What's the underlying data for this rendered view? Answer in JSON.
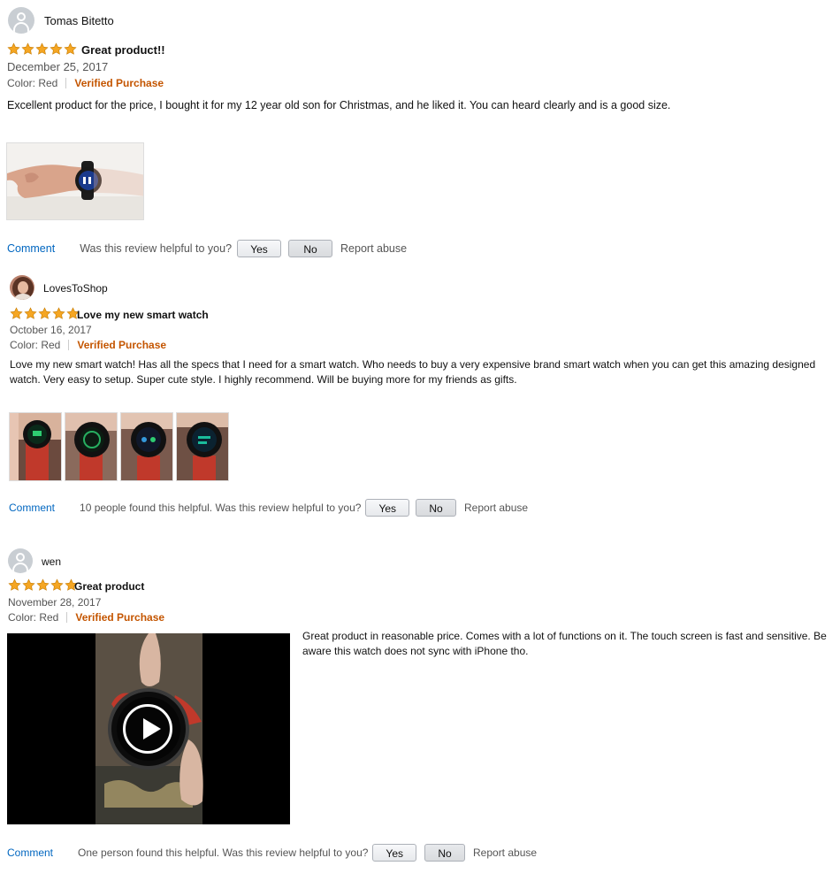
{
  "colors": {
    "link": "#0066c0",
    "verified": "#c45500",
    "star": "#f5a623"
  },
  "reviews": [
    {
      "author": "Tomas Bitetto",
      "rating": 5,
      "title": "Great product!!",
      "date": "December 25, 2017",
      "color": "Color: Red",
      "verified": "Verified Purchase",
      "text": "Excellent product for the price, I bought it for my 12 year old son for Christmas, and he liked it. You can heard clearly and is a good size.",
      "helpful": "Was this review helpful to you?",
      "comment": "Comment",
      "yes": "Yes",
      "no": "No",
      "report": "Report abuse"
    },
    {
      "author": "LovesToShop",
      "rating": 5,
      "title": "Love my new smart watch",
      "date": "October 16, 2017",
      "color": "Color: Red",
      "verified": "Verified Purchase",
      "text": "Love my new smart watch! Has all the specs that I need for a smart watch. Who needs to buy a very expensive brand smart watch when you can get this amazing designed watch. Very easy to setup. Super cute style. I highly recommend. Will be buying more for my friends as gifts.",
      "helpful": "10 people found this helpful. Was this review helpful to you?",
      "comment": "Comment",
      "yes": "Yes",
      "no": "No",
      "report": "Report abuse"
    },
    {
      "author": "wen",
      "rating": 5,
      "title": "Great product",
      "date": "November 28, 2017",
      "color": "Color: Red",
      "verified": "Verified Purchase",
      "text": " Great product in reasonable price. Comes with a lot of functions on it. The touch screen is fast and sensitive. Be aware this watch does not sync with iPhone tho.",
      "helpful": "One person found this helpful. Was this review helpful to you?",
      "comment": "Comment",
      "yes": "Yes",
      "no": "No",
      "report": "Report abuse"
    }
  ]
}
